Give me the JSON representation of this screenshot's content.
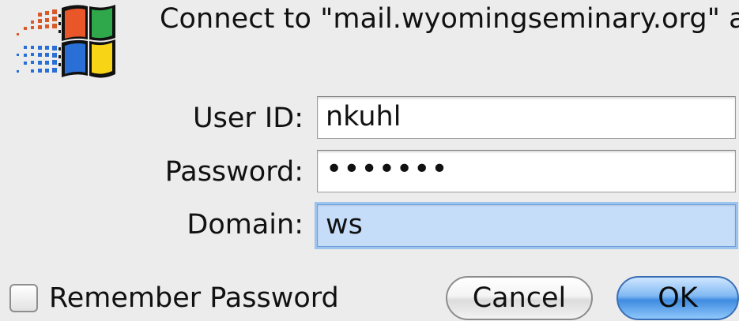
{
  "dialog": {
    "heading": "Connect to \"mail.wyomingseminary.org\" as:",
    "logo_icon": "windows-logo-icon"
  },
  "form": {
    "user_id_label": "User ID:",
    "user_id_value": "nkuhl",
    "password_label": "Password:",
    "password_value": "•••••••",
    "domain_label": "Domain:",
    "domain_value": "ws"
  },
  "options": {
    "remember_password_label": "Remember Password",
    "remember_password_checked": false
  },
  "buttons": {
    "cancel_label": "Cancel",
    "ok_label": "OK"
  },
  "colors": {
    "logo_red": "#e8562a",
    "logo_green": "#2ea84a",
    "logo_blue": "#2a6fd6",
    "logo_yellow": "#f7d416",
    "focus_fill": "#c6ddfa",
    "default_button": "#3f8be0"
  }
}
